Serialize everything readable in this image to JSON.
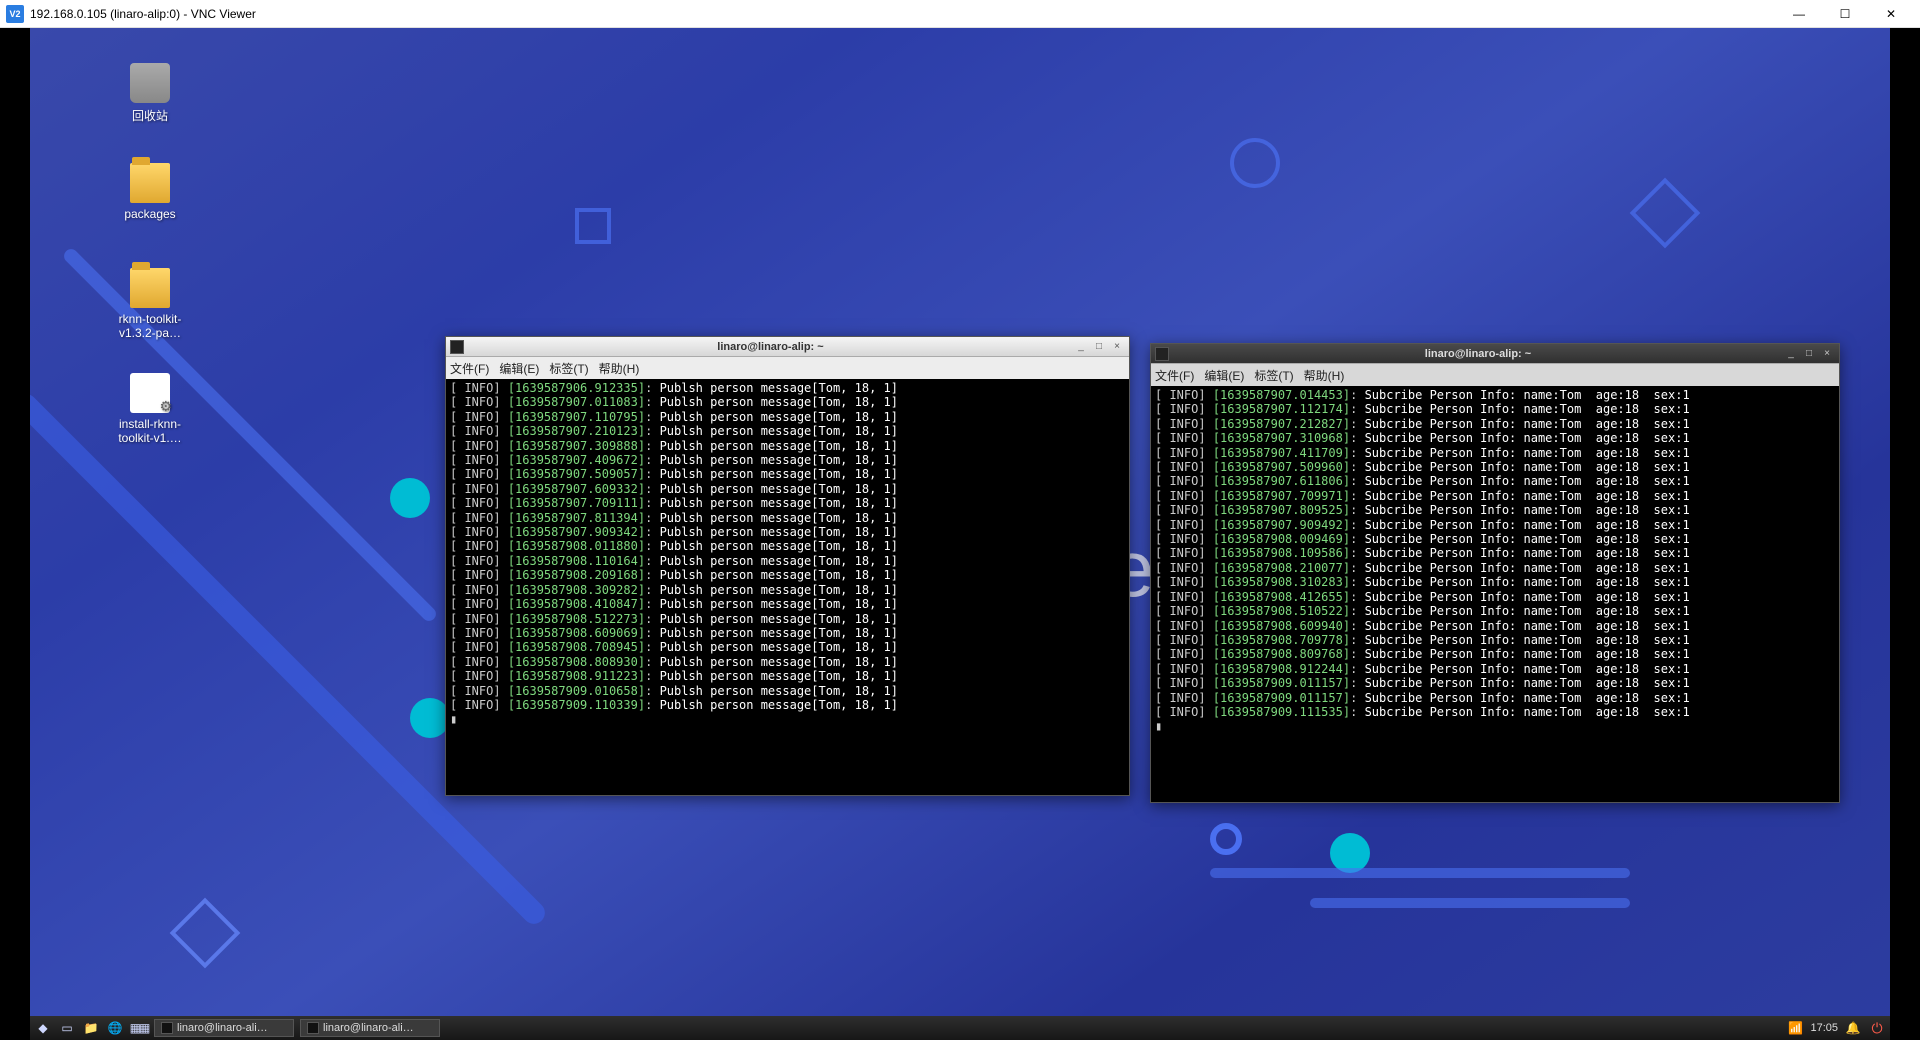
{
  "vnc": {
    "app_icon_text": "V2",
    "title": "192.168.0.105 (linaro-alip:0) - VNC Viewer",
    "min": "—",
    "max": "☐",
    "close": "✕"
  },
  "desktop_icons": [
    {
      "label": "回收站",
      "kind": "trash"
    },
    {
      "label": "packages",
      "kind": "folder"
    },
    {
      "label": "rknn-toolkit-v1.3.2-pa…",
      "kind": "folder"
    },
    {
      "label": "install-rknn-toolkit-v1.…",
      "kind": "script"
    }
  ],
  "menus": {
    "file": "文件(F)",
    "edit": "编辑(E)",
    "tabs": "标签(T)",
    "help": "帮助(H)"
  },
  "terminal_common_title": "linaro@linaro-alip: ~",
  "term1": {
    "lines": [
      {
        "ts": "1639587906.912335",
        "m": "Publsh person message[Tom, 18, 1]"
      },
      {
        "ts": "1639587907.011083",
        "m": "Publsh person message[Tom, 18, 1]"
      },
      {
        "ts": "1639587907.110795",
        "m": "Publsh person message[Tom, 18, 1]"
      },
      {
        "ts": "1639587907.210123",
        "m": "Publsh person message[Tom, 18, 1]"
      },
      {
        "ts": "1639587907.309888",
        "m": "Publsh person message[Tom, 18, 1]"
      },
      {
        "ts": "1639587907.409672",
        "m": "Publsh person message[Tom, 18, 1]"
      },
      {
        "ts": "1639587907.509057",
        "m": "Publsh person message[Tom, 18, 1]"
      },
      {
        "ts": "1639587907.609332",
        "m": "Publsh person message[Tom, 18, 1]"
      },
      {
        "ts": "1639587907.709111",
        "m": "Publsh person message[Tom, 18, 1]"
      },
      {
        "ts": "1639587907.811394",
        "m": "Publsh person message[Tom, 18, 1]"
      },
      {
        "ts": "1639587907.909342",
        "m": "Publsh person message[Tom, 18, 1]"
      },
      {
        "ts": "1639587908.011880",
        "m": "Publsh person message[Tom, 18, 1]"
      },
      {
        "ts": "1639587908.110164",
        "m": "Publsh person message[Tom, 18, 1]"
      },
      {
        "ts": "1639587908.209168",
        "m": "Publsh person message[Tom, 18, 1]"
      },
      {
        "ts": "1639587908.309282",
        "m": "Publsh person message[Tom, 18, 1]"
      },
      {
        "ts": "1639587908.410847",
        "m": "Publsh person message[Tom, 18, 1]"
      },
      {
        "ts": "1639587908.512273",
        "m": "Publsh person message[Tom, 18, 1]"
      },
      {
        "ts": "1639587908.609069",
        "m": "Publsh person message[Tom, 18, 1]"
      },
      {
        "ts": "1639587908.708945",
        "m": "Publsh person message[Tom, 18, 1]"
      },
      {
        "ts": "1639587908.808930",
        "m": "Publsh person message[Tom, 18, 1]"
      },
      {
        "ts": "1639587908.911223",
        "m": "Publsh person message[Tom, 18, 1]"
      },
      {
        "ts": "1639587909.010658",
        "m": "Publsh person message[Tom, 18, 1]"
      },
      {
        "ts": "1639587909.110339",
        "m": "Publsh person message[Tom, 18, 1]"
      }
    ]
  },
  "term2": {
    "lines": [
      {
        "ts": "1639587907.014453",
        "m": "Subcribe Person Info: name:Tom  age:18  sex:1"
      },
      {
        "ts": "1639587907.112174",
        "m": "Subcribe Person Info: name:Tom  age:18  sex:1"
      },
      {
        "ts": "1639587907.212827",
        "m": "Subcribe Person Info: name:Tom  age:18  sex:1"
      },
      {
        "ts": "1639587907.310968",
        "m": "Subcribe Person Info: name:Tom  age:18  sex:1"
      },
      {
        "ts": "1639587907.411709",
        "m": "Subcribe Person Info: name:Tom  age:18  sex:1"
      },
      {
        "ts": "1639587907.509960",
        "m": "Subcribe Person Info: name:Tom  age:18  sex:1"
      },
      {
        "ts": "1639587907.611806",
        "m": "Subcribe Person Info: name:Tom  age:18  sex:1"
      },
      {
        "ts": "1639587907.709971",
        "m": "Subcribe Person Info: name:Tom  age:18  sex:1"
      },
      {
        "ts": "1639587907.809525",
        "m": "Subcribe Person Info: name:Tom  age:18  sex:1"
      },
      {
        "ts": "1639587907.909492",
        "m": "Subcribe Person Info: name:Tom  age:18  sex:1"
      },
      {
        "ts": "1639587908.009469",
        "m": "Subcribe Person Info: name:Tom  age:18  sex:1"
      },
      {
        "ts": "1639587908.109586",
        "m": "Subcribe Person Info: name:Tom  age:18  sex:1"
      },
      {
        "ts": "1639587908.210077",
        "m": "Subcribe Person Info: name:Tom  age:18  sex:1"
      },
      {
        "ts": "1639587908.310283",
        "m": "Subcribe Person Info: name:Tom  age:18  sex:1"
      },
      {
        "ts": "1639587908.412655",
        "m": "Subcribe Person Info: name:Tom  age:18  sex:1"
      },
      {
        "ts": "1639587908.510522",
        "m": "Subcribe Person Info: name:Tom  age:18  sex:1"
      },
      {
        "ts": "1639587908.609940",
        "m": "Subcribe Person Info: name:Tom  age:18  sex:1"
      },
      {
        "ertts": "",
        "ts": "1639587908.709778",
        "m": "Subcribe Person Info: name:Tom  age:18  sex:1"
      },
      {
        "ts": "1639587908.809768",
        "m": "Subcribe Person Info: name:Tom  age:18  sex:1"
      },
      {
        "ts": "1639587908.912244",
        "m": "Subcribe Person Info: name:Tom  age:18  sex:1"
      },
      {
        "ts": "1639587909.011157",
        "m": "Subcribe Person Info: name:Tom  age:18  sex:1"
      },
      {
        "ts": "1639587909.011157",
        "m": "Subcribe Person Info: name:Tom  age:18  sex:1"
      },
      {
        "ts": "1639587909.111535",
        "m": "Subcribe Person Info: name:Tom  age:18  sex:1"
      }
    ]
  },
  "taskbar": {
    "items": [
      "linaro@linaro-ali…",
      "linaro@linaro-ali…"
    ],
    "clock": "17:05"
  },
  "wincontrols": {
    "min": "_",
    "max": "□",
    "close": "×"
  }
}
